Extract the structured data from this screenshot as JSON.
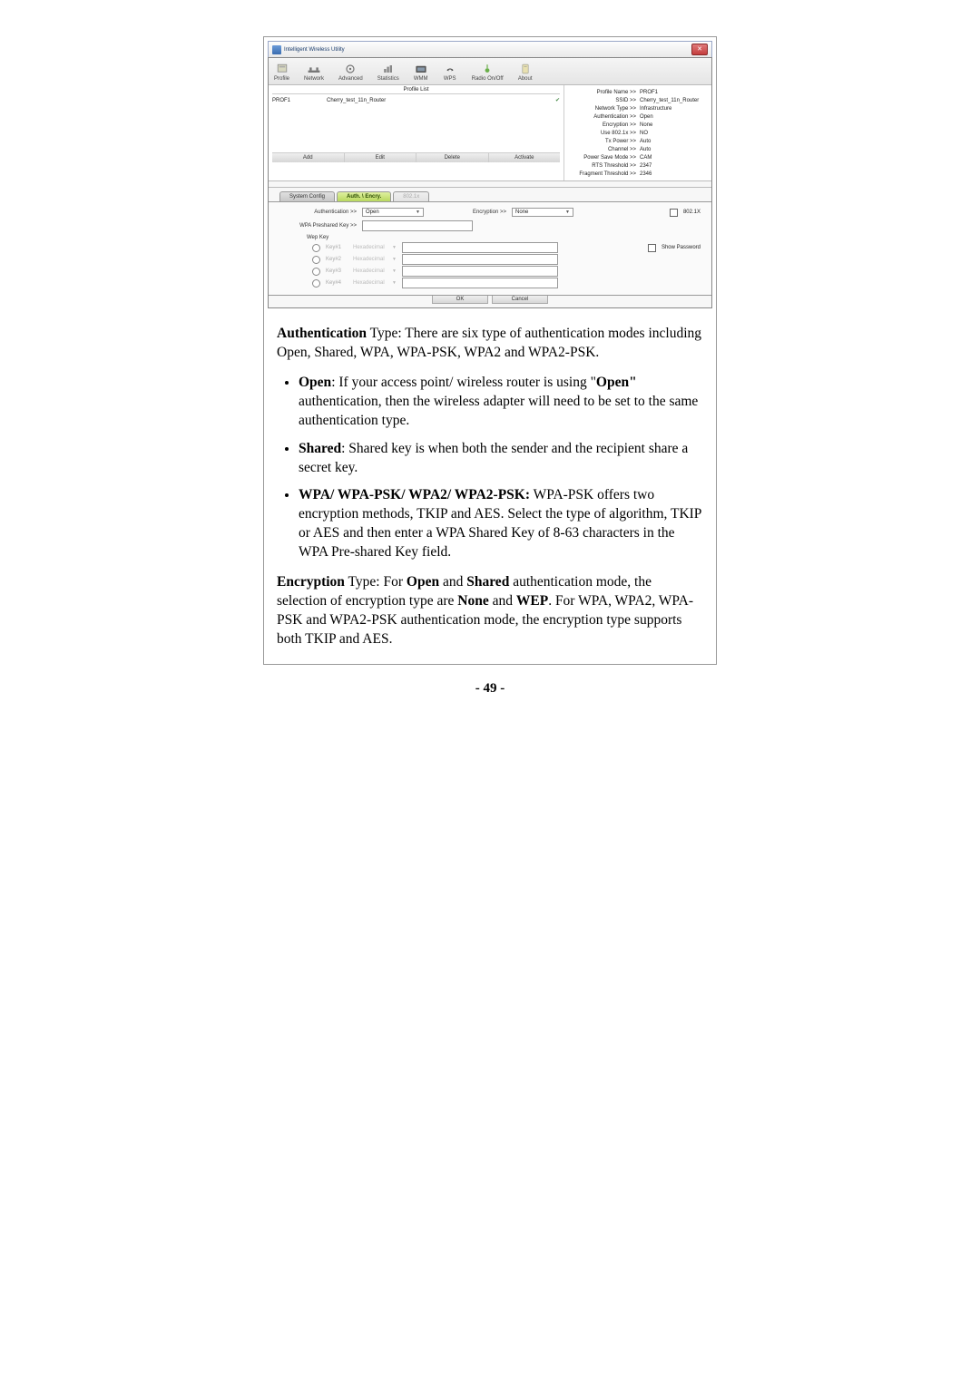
{
  "screenshot": {
    "window_title": "Intelligent Wireless Utility",
    "toolbar": [
      "Profile",
      "Network",
      "Advanced",
      "Statistics",
      "WMM",
      "WPS",
      "Radio On/Off",
      "About"
    ],
    "profile_list_label": "Profile List",
    "profile": {
      "name": "PROF1",
      "ssid": "Cherry_test_11n_Router"
    },
    "profile_buttons": [
      "Add",
      "Edit",
      "Delete",
      "Activate"
    ],
    "details": [
      {
        "k": "Profile Name >>",
        "v": "PROF1"
      },
      {
        "k": "SSID >>",
        "v": "Cherry_test_11n_Router"
      },
      {
        "k": "Network Type >>",
        "v": "Infrastructure"
      },
      {
        "k": "Authentication >>",
        "v": "Open"
      },
      {
        "k": "Encryption >>",
        "v": "None"
      },
      {
        "k": "Use 802.1x >>",
        "v": "NO"
      },
      {
        "k": "Tx Power >>",
        "v": "Auto"
      },
      {
        "k": "Channel >>",
        "v": "Auto"
      },
      {
        "k": "Power Save Mode >>",
        "v": "CAM"
      },
      {
        "k": "RTS Threshold >>",
        "v": "2347"
      },
      {
        "k": "Fragment Threshold >>",
        "v": "2346"
      }
    ],
    "tabs": {
      "system": "System Config",
      "auth": "Auth. \\ Encry.",
      "dot1x": "802.1x"
    },
    "form": {
      "auth_label": "Authentication >>",
      "auth_value": "Open",
      "enc_label": "Encryption >>",
      "enc_value": "None",
      "dot1x_check": "802.1X",
      "psk_label": "WPA Preshared Key >>",
      "wep_label": "Wep Key",
      "keys": [
        {
          "k": "Key#1",
          "h": "Hexadecimal"
        },
        {
          "k": "Key#2",
          "h": "Hexadecimal"
        },
        {
          "k": "Key#3",
          "h": "Hexadecimal"
        },
        {
          "k": "Key#4",
          "h": "Hexadecimal"
        }
      ],
      "show_pw": "Show Password",
      "ok": "OK",
      "cancel": "Cancel"
    }
  },
  "doc": {
    "p1_a": "Authentication",
    "p1_b": " Type: There are six type of authentication modes including Open, Shared, WPA, WPA-PSK, WPA2 and WPA2-PSK.",
    "li1_a": "Open",
    "li1_b": ": If your access point/ wireless router is using \"",
    "li1_c": "Open\"",
    "li1_d": " authentication, then the wireless adapter will need to be set to the same authentication type.",
    "li2_a": "Shared",
    "li2_b": ": Shared key is when both the sender and the recipient share a secret key.",
    "li3_a": "WPA/ WPA-PSK/ WPA2/ WPA2-PSK:",
    "li3_b": " WPA-PSK offers two encryption methods, TKIP and AES. Select the type of algorithm, TKIP or AES and then enter a WPA Shared Key of 8-63 characters in the WPA Pre-shared Key field.",
    "p2_a": "Encryption",
    "p2_b": " Type: For ",
    "p2_c": "Open",
    "p2_d": " and ",
    "p2_e": "Shared",
    "p2_f": " authentication mode, the selection of encryption type are ",
    "p2_g": "None",
    "p2_h": " and ",
    "p2_i": "WEP",
    "p2_j": ". For WPA, WPA2, WPA-PSK and WPA2-PSK authentication mode, the encryption type supports both TKIP and AES."
  },
  "page_number": "- 49 -"
}
